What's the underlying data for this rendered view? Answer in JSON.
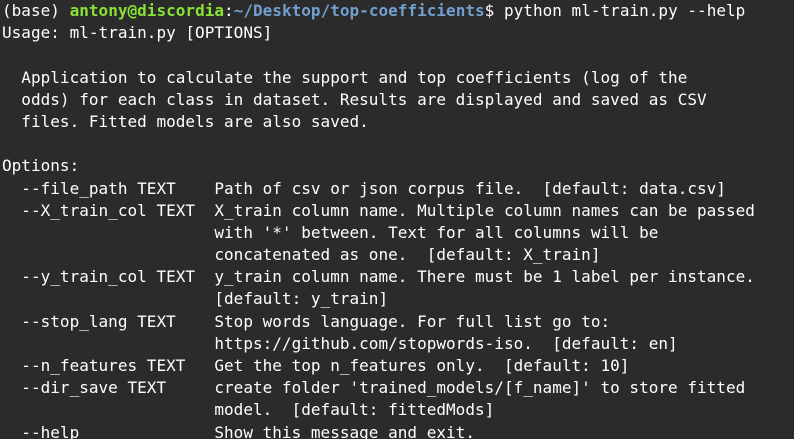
{
  "prompt": {
    "env": "(base) ",
    "user_host": "antony@discordia",
    "colon": ":",
    "path": "~/Desktop/top-coefficients",
    "symbol": "$",
    "command": " python ml-train.py --help"
  },
  "colors": {
    "background": "#2b2b2b",
    "text": "#ffffff",
    "user_host": "#8ae234",
    "path": "#729fcf"
  },
  "output": {
    "lines": [
      "Usage: ml-train.py [OPTIONS]",
      "",
      "  Application to calculate the support and top coefficients (log of the",
      "  odds) for each class in dataset. Results are displayed and saved as CSV",
      "  files. Fitted models are also saved.",
      "",
      "Options:",
      "  --file_path TEXT    Path of csv or json corpus file.  [default: data.csv]",
      "  --X_train_col TEXT  X_train column name. Multiple column names can be passed",
      "                      with '*' between. Text for all columns will be",
      "                      concatenated as one.  [default: X_train]",
      "  --y_train_col TEXT  y_train column name. There must be 1 label per instance.",
      "                      [default: y_train]",
      "  --stop_lang TEXT    Stop words language. For full list go to:",
      "                      https://github.com/stopwords-iso.  [default: en]",
      "  --n_features TEXT   Get the top n_features only.  [default: 10]",
      "  --dir_save TEXT     create folder 'trained_models/[f_name]' to store fitted",
      "                      model.  [default: fittedMods]",
      "  --help              Show this message and exit."
    ]
  }
}
